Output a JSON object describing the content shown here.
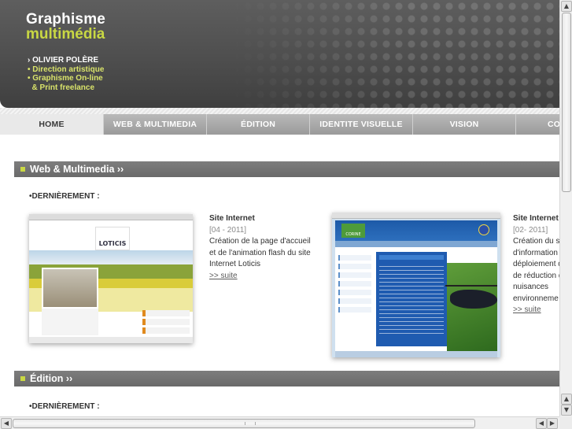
{
  "banner": {
    "logo_line1": "Graphisme",
    "logo_line2": "multimédia",
    "tagline_name": "› OLIVIER POLÈRE",
    "tagline_lines": [
      "• Direction artistique",
      "• Graphisme On-line",
      "  & Print freelance"
    ]
  },
  "nav": {
    "items": [
      "HOME",
      "WEB & MULTIMEDIA",
      "ÉDITION",
      "IDENTITE VISUELLE",
      "VISION",
      "CO"
    ],
    "active_index": 0
  },
  "sections": [
    {
      "title": "Web & Multimedia ››",
      "recent_label": "•DERNIÈREMENT :",
      "projects": [
        {
          "thumb_logo": "LOTICIS",
          "title": "Site Internet",
          "date": "[04 - 2011]",
          "desc_lines": [
            "Création de la page d'accueil",
            "et de l'animation flash du site",
            "Internet Loticis"
          ],
          "link": ">> suite"
        },
        {
          "thumb_logo": "CORINE",
          "title": "Site Internet",
          "date": "[02- 2011]",
          "desc_lines": [
            "Création du s",
            "d'information s",
            "déploiement d",
            "de réduction d",
            "nuisances",
            "environneme"
          ],
          "link": ">> suite"
        }
      ]
    },
    {
      "title": "Édition ››",
      "recent_label": "•DERNIÈREMENT :"
    }
  ],
  "scroll": {
    "up_arrow": "▲",
    "down_arrow": "▼",
    "left_arrow": "◀",
    "right_arrow": "▶"
  },
  "colors": {
    "accent": "#c9d843",
    "banner": "#4e4e4e",
    "section_bar": "#737373"
  }
}
